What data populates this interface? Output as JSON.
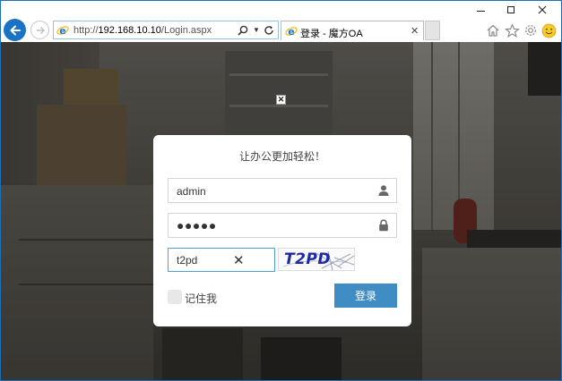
{
  "browser": {
    "address": {
      "protocol": "http://",
      "host": "192.168.10.10",
      "path": "/Login.aspx"
    },
    "tab": {
      "title": "登录 - 魔方OA"
    }
  },
  "login": {
    "heading": "让办公更加轻松！",
    "username": "admin",
    "password_mask": "●●●●●",
    "captcha_input": "t2pd",
    "captcha_image_text": "T2PD",
    "remember_label": "记住我",
    "submit_label": "登录"
  },
  "colors": {
    "accent": "#3f8dc3",
    "browser_back": "#1a73c4",
    "captcha_text": "#1d2aa8"
  }
}
